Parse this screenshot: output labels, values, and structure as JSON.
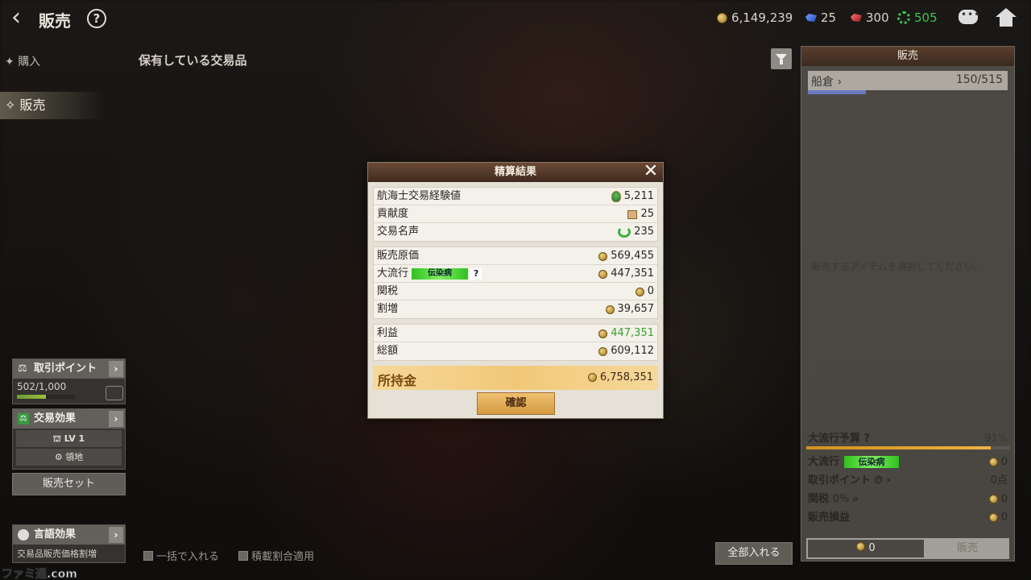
{
  "header": {
    "title": "販売",
    "help": "?"
  },
  "currencies": [
    {
      "icon": "coin-icon",
      "value": "6,149,239"
    },
    {
      "icon": "blue-gem-icon",
      "value": "25"
    },
    {
      "icon": "red-gem-icon",
      "value": "300"
    },
    {
      "icon": "green-gear-icon",
      "value": "505"
    }
  ],
  "nav": {
    "buy_label": "購入",
    "sell_label": "販売"
  },
  "section_title": "保有している交易品",
  "left_panels": {
    "trade_points": {
      "title": "取引ポイント",
      "value": "502/1,000",
      "fill": 0.502
    },
    "trade_effect": {
      "title": "交易効果",
      "level": "LV 1",
      "territory": "領地"
    },
    "sell_set_label": "販売セット",
    "language": {
      "title": "言語効果",
      "desc": "交易品販売価格割増"
    }
  },
  "bottom_controls": {
    "batch_label": "一括で入れる",
    "ratio_label": "積載割合適用",
    "all_in_label": "全部入れる"
  },
  "right_panel": {
    "title": "販売",
    "hold_label": "船倉",
    "hold_value": "150/515",
    "hold_fill": 0.291,
    "empty_msg": "販売するアイテムを選択してください。",
    "budget_label": "大流行予算",
    "budget_value": "91%",
    "budget_fill": 0.91,
    "trend_label": "大流行",
    "trend_tag": "伝染病",
    "trend_value": "0",
    "points_label": "取引ポイント",
    "points_value": "0点",
    "tax_label": "関税",
    "tax_rate": "0%",
    "tax_value": "0",
    "loss_label": "販売損益",
    "loss_value": "0",
    "count_value": "0",
    "sell_button": "販売"
  },
  "modal": {
    "title": "精算結果",
    "group1": [
      {
        "label": "航海士交易経験値",
        "icon": "medal-icon",
        "value": "5,211"
      },
      {
        "label": "貢献度",
        "icon": "scroll-icon",
        "value": "25"
      },
      {
        "label": "交易名声",
        "icon": "laurel-icon",
        "value": "235"
      }
    ],
    "group2": {
      "cost_label": "販売原価",
      "cost_value": "569,455",
      "trend_label": "大流行",
      "trend_tag": "伝染病",
      "trend_q": "?",
      "trend_value": "447,351",
      "tax_label": "関税",
      "tax_value": "0",
      "bonus_label": "割増",
      "bonus_value": "39,657"
    },
    "group3": {
      "profit_label": "利益",
      "profit_value": "447,351",
      "total_label": "総額",
      "total_value": "609,112"
    },
    "gold_label": "所持金",
    "gold_value": "6,758,351",
    "confirm_label": "確認"
  },
  "watermark": "ファミ通.com"
}
